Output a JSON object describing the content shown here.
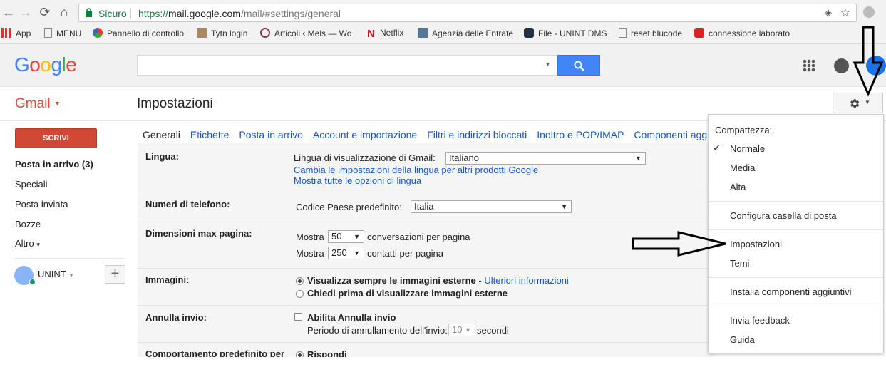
{
  "browser": {
    "secure_label": "Sicuro",
    "url_scheme": "https://",
    "url_host": "mail.google.com",
    "url_path": "/mail/#settings/general",
    "bookmarks": [
      {
        "label": "App"
      },
      {
        "label": "MENU"
      },
      {
        "label": "Pannello di controllo"
      },
      {
        "label": "Tytn login"
      },
      {
        "label": "Articoli ‹ Mels — Wo"
      },
      {
        "label": "Netflix"
      },
      {
        "label": "Agenzia delle Entrate"
      },
      {
        "label": "File - UNINT DMS"
      },
      {
        "label": "reset blucode"
      },
      {
        "label": "connessione laborato"
      }
    ]
  },
  "google": {
    "logo": "Google",
    "search_placeholder": ""
  },
  "gmail": {
    "label": "Gmail",
    "page_title": "Impostazioni",
    "compose": "SCRIVI",
    "sidebar": [
      {
        "label": "Posta in arrivo (3)",
        "bold": true
      },
      {
        "label": "Speciali"
      },
      {
        "label": "Posta inviata"
      },
      {
        "label": "Bozze"
      },
      {
        "label": "Altro"
      }
    ],
    "account": "UNINT"
  },
  "settings": {
    "tabs": [
      "Generali",
      "Etichette",
      "Posta in arrivo",
      "Account e importazione",
      "Filtri e indirizzi bloccati",
      "Inoltro e POP/IMAP",
      "Componenti agg"
    ],
    "lingua": {
      "label": "Lingua:",
      "display_label": "Lingua di visualizzazione di Gmail:",
      "value": "Italiano",
      "link1": "Cambia le impostazioni della lingua per altri prodotti Google",
      "link2": "Mostra tutte le opzioni di lingua"
    },
    "telefono": {
      "label": "Numeri di telefono:",
      "country_label": "Codice Paese predefinito:",
      "value": "Italia"
    },
    "pagina": {
      "label": "Dimensioni max pagina:",
      "show": "Mostra",
      "conv_value": "50",
      "conv_text": "conversazioni per pagina",
      "contacts_value": "250",
      "contacts_text": "contatti per pagina"
    },
    "immagini": {
      "label": "Immagini:",
      "opt1": "Visualizza sempre le immagini esterne",
      "opt1_sep": " - ",
      "opt1_link": "Ulteriori informazioni",
      "opt2": "Chiedi prima di visualizzare immagini esterne"
    },
    "annulla": {
      "label": "Annulla invio:",
      "enable": "Abilita Annulla invio",
      "period_label": "Periodo di annullamento dell'invio:",
      "period_value": "10",
      "seconds": "secondi"
    },
    "comportamento": {
      "label": "Comportamento predefinito per",
      "opt1": "Rispondi"
    }
  },
  "gear_menu": {
    "header": "Compattezza:",
    "density": [
      {
        "label": "Normale",
        "checked": true
      },
      {
        "label": "Media"
      },
      {
        "label": "Alta"
      }
    ],
    "items": [
      "Configura casella di posta",
      "Impostazioni",
      "Temi",
      "Installa componenti aggiuntivi",
      "Invia feedback",
      "Guida"
    ]
  },
  "colors": {
    "gmail_red": "#dd4b39",
    "compose_red": "#d14836",
    "link_blue": "#1155cc",
    "search_blue": "#4285f4"
  }
}
